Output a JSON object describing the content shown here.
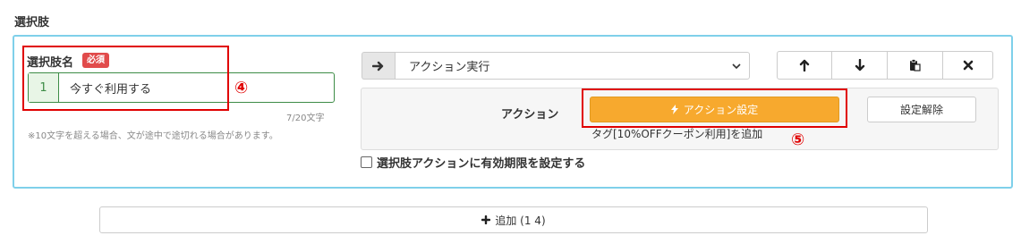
{
  "section": {
    "title": "選択肢"
  },
  "choice": {
    "name_label": "選択肢名",
    "required_badge": "必須",
    "index": "1",
    "value": "今すぐ利用する",
    "char_count": "7/20文字",
    "hint": "※10文字を超える場合、文が途中で途切れる場合があります。"
  },
  "markers": {
    "four": "④",
    "five": "⑤"
  },
  "action": {
    "select_value": "アクション実行",
    "label": "アクション",
    "settings_button": "アクション設定",
    "clear_button": "設定解除",
    "description": "タグ[10%OFFクーポン利用]を追加"
  },
  "expire": {
    "label": "選択肢アクションに有効期限を設定する",
    "checked": false
  },
  "add": {
    "label": "追加 (1 4)"
  },
  "icons": {
    "arrow": "arrow-right-icon",
    "chevron": "chevron-down-icon",
    "up": "arrow-up-icon",
    "down": "arrow-down-icon",
    "paste": "clipboard-icon",
    "close": "close-icon",
    "bolt": "lightning-icon",
    "plus": "plus-icon"
  },
  "colors": {
    "panel_border": "#7fd0ea",
    "accent_green": "#3d8c46",
    "action_orange": "#f7a92e",
    "badge_red": "#e14b4b",
    "annotation_red": "#e00000"
  }
}
